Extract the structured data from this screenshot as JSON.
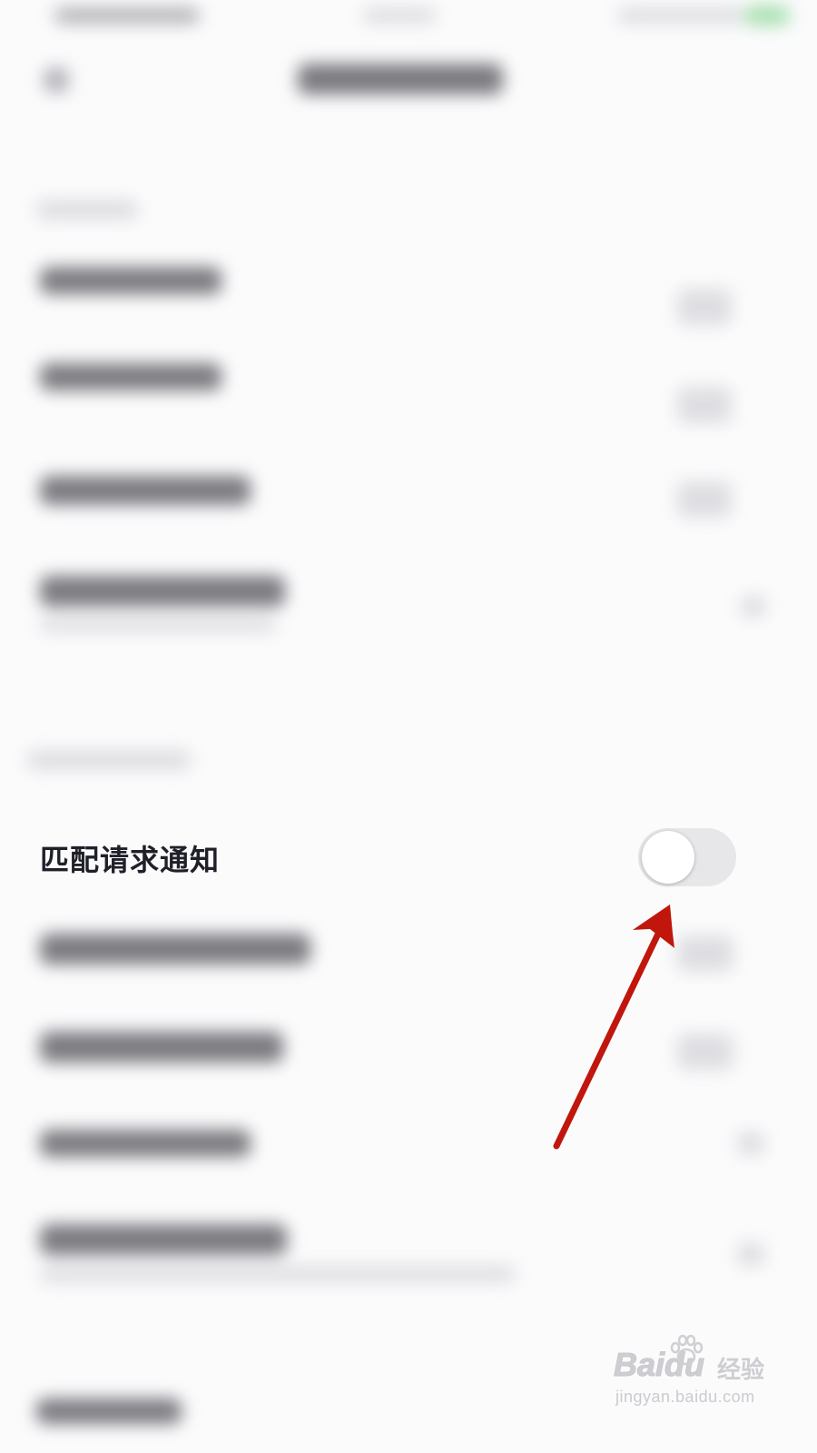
{
  "row": {
    "label": "匹配请求通知",
    "toggle_state": "off"
  },
  "watermark": {
    "logo": "Baidu",
    "brand": "经验",
    "url": "jingyan.baidu.com"
  },
  "colors": {
    "arrow": "#c0160c",
    "toggle_track": "#e7e7ea",
    "label": "#20202a"
  }
}
